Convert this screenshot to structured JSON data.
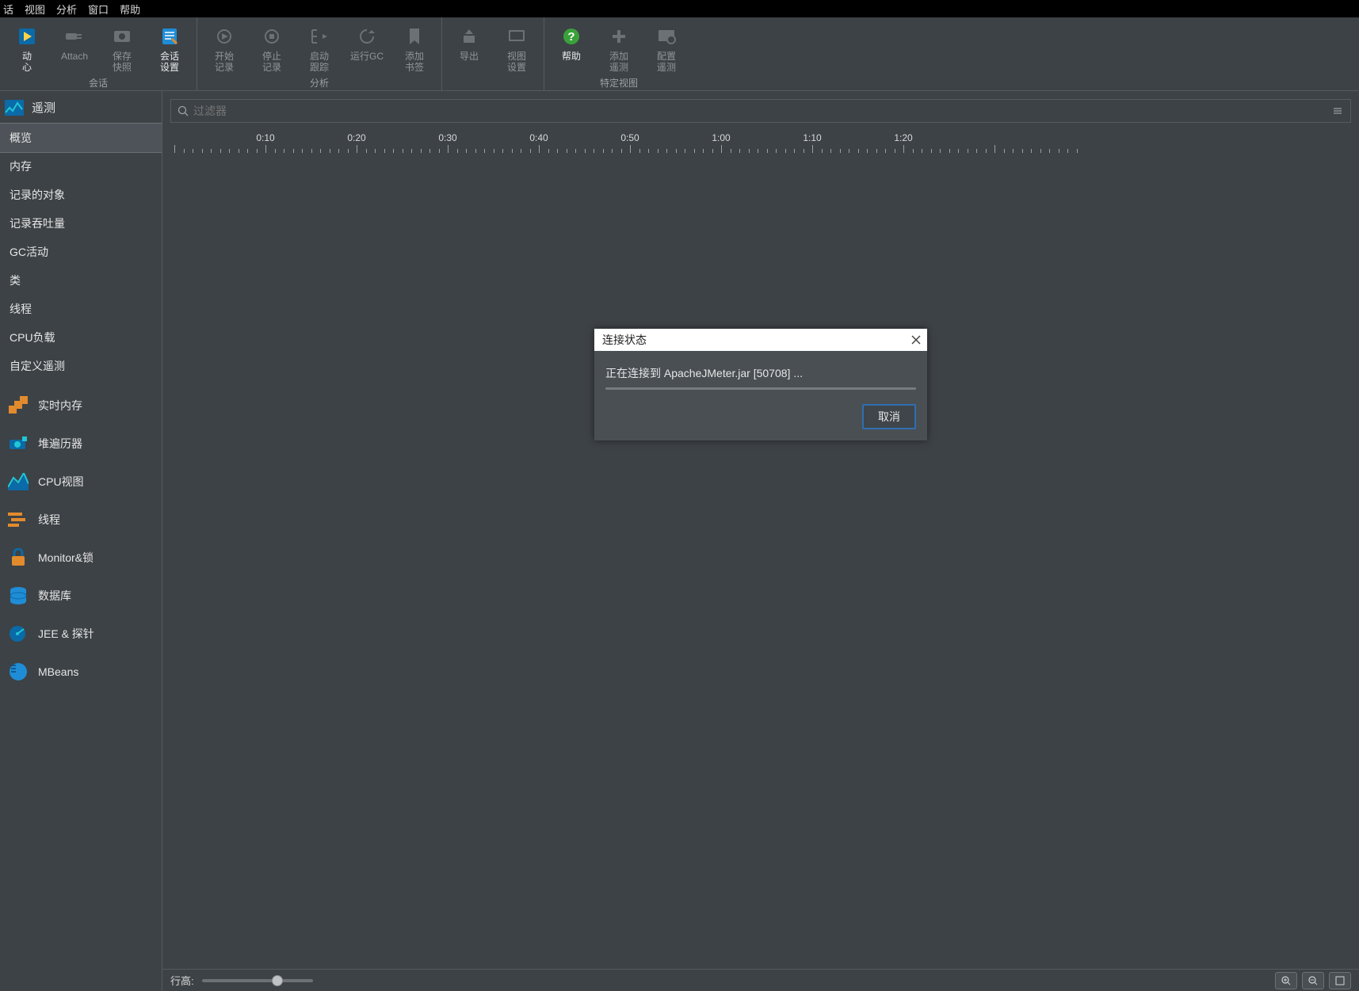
{
  "menu": {
    "items": [
      "话",
      "视图",
      "分析",
      "窗口",
      "帮助"
    ]
  },
  "ribbon": {
    "groups": [
      {
        "label": "会话",
        "buttons": [
          {
            "id": "start",
            "icon": "start",
            "l1": "动",
            "l2": "心",
            "enabled": true
          },
          {
            "id": "attach",
            "icon": "plug",
            "l1": "Attach",
            "l2": "",
            "enabled": false
          },
          {
            "id": "snapshot",
            "icon": "snapshot",
            "l1": "保存",
            "l2": "快照",
            "enabled": false
          },
          {
            "id": "settings",
            "icon": "settings",
            "l1": "会话",
            "l2": "设置",
            "enabled": true
          }
        ]
      },
      {
        "label": "分析",
        "buttons": [
          {
            "id": "rec-start",
            "icon": "rec-start",
            "l1": "开始",
            "l2": "记录",
            "enabled": false
          },
          {
            "id": "rec-stop",
            "icon": "rec-stop",
            "l1": "停止",
            "l2": "记录",
            "enabled": false
          },
          {
            "id": "trace",
            "icon": "trace",
            "l1": "启动",
            "l2": "跟踪",
            "enabled": false
          },
          {
            "id": "gc",
            "icon": "gc",
            "l1": "运行GC",
            "l2": "",
            "enabled": false
          },
          {
            "id": "bookmark",
            "icon": "bookmark",
            "l1": "添加",
            "l2": "书签",
            "enabled": false
          }
        ]
      },
      {
        "label": "",
        "buttons": [
          {
            "id": "export",
            "icon": "export",
            "l1": "导出",
            "l2": "",
            "enabled": false
          },
          {
            "id": "viewcfg",
            "icon": "viewcfg",
            "l1": "视图",
            "l2": "设置",
            "enabled": false
          }
        ]
      },
      {
        "label": "特定视图",
        "buttons": [
          {
            "id": "help",
            "icon": "help",
            "l1": "帮助",
            "l2": "",
            "enabled": true
          },
          {
            "id": "add-tele",
            "icon": "add",
            "l1": "添加",
            "l2": "遥测",
            "enabled": false
          },
          {
            "id": "cfg-tele",
            "icon": "cfg",
            "l1": "配置",
            "l2": "遥测",
            "enabled": false
          }
        ]
      }
    ]
  },
  "sidebar": {
    "title": "遥测",
    "items": [
      "概览",
      "内存",
      "记录的对象",
      "记录吞吐量",
      "GC活动",
      "类",
      "线程",
      "CPU负载",
      "自定义遥测"
    ],
    "selected": 0,
    "tools": [
      {
        "icon": "mem",
        "label": "实时内存"
      },
      {
        "icon": "heap",
        "label": "堆遍历器"
      },
      {
        "icon": "cpu",
        "label": "CPU视图"
      },
      {
        "icon": "thread",
        "label": "线程"
      },
      {
        "icon": "lock",
        "label": "Monitor&锁"
      },
      {
        "icon": "db",
        "label": "数据库"
      },
      {
        "icon": "probe",
        "label": "JEE & 探针"
      },
      {
        "icon": "mbean",
        "label": "MBeans"
      }
    ]
  },
  "filter": {
    "placeholder": "过滤器"
  },
  "ruler": {
    "labels": [
      "0:10",
      "0:20",
      "0:30",
      "0:40",
      "0:50",
      "1:00",
      "1:10",
      "1:20"
    ]
  },
  "status": {
    "rowHeight": "行高:"
  },
  "dialog": {
    "title": "连接状态",
    "message": "正在连接到 ApacheJMeter.jar [50708] ...",
    "cancel": "取消"
  }
}
